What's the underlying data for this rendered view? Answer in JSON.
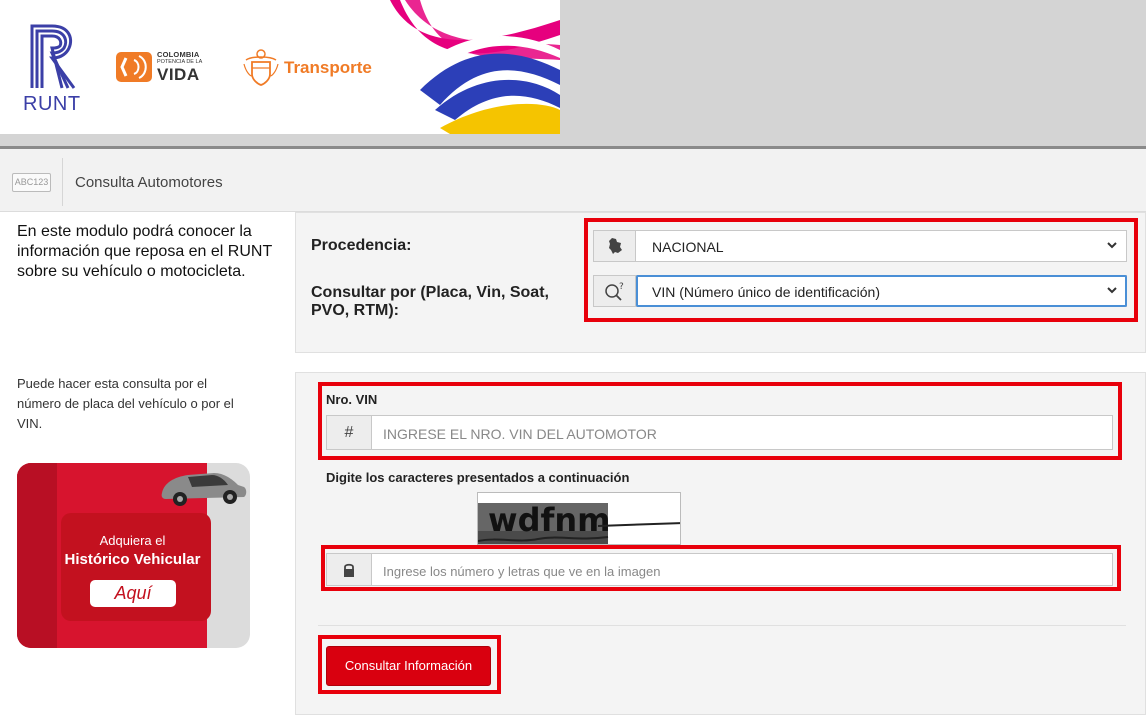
{
  "header": {
    "runt_label": "RUNT",
    "colombia_line1": "COLOMBIA",
    "colombia_line2": "POTENCIA DE LA",
    "colombia_line3": "VIDA",
    "transporte_label": "Transporte"
  },
  "titlebar": {
    "icon_text": "ABC123",
    "title": "Consulta Automotores"
  },
  "left": {
    "intro": "En este modulo podrá conocer la información que reposa en el RUNT sobre su vehículo o motocicleta.",
    "note": "Puede hacer esta consulta por el número de placa del vehículo o por el VIN.",
    "promo": {
      "line1": "Adquiera el",
      "line2": "Histórico Vehicular",
      "button": "Aquí"
    }
  },
  "form": {
    "procedencia_label": "Procedencia:",
    "procedencia_value": "NACIONAL",
    "consultar_label": "Consultar por (Placa, Vin, Soat, PVO, RTM):",
    "consultar_value": "VIN (Número único de identificación)",
    "vin_label": "Nro. VIN",
    "vin_icon": "#",
    "vin_placeholder": "INGRESE EL NRO. VIN DEL AUTOMOTOR",
    "captcha_label": "Digite los caracteres presentados a continuación",
    "captcha_text": "wdfnm",
    "captcha_placeholder": "Ingrese los número y letras que ve en la imagen",
    "submit_label": "Consultar Información"
  },
  "colors": {
    "highlight": "#e8000b",
    "button": "#d9000f",
    "runt_blue": "#3b3fa7",
    "transporte_orange": "#f07b26"
  }
}
